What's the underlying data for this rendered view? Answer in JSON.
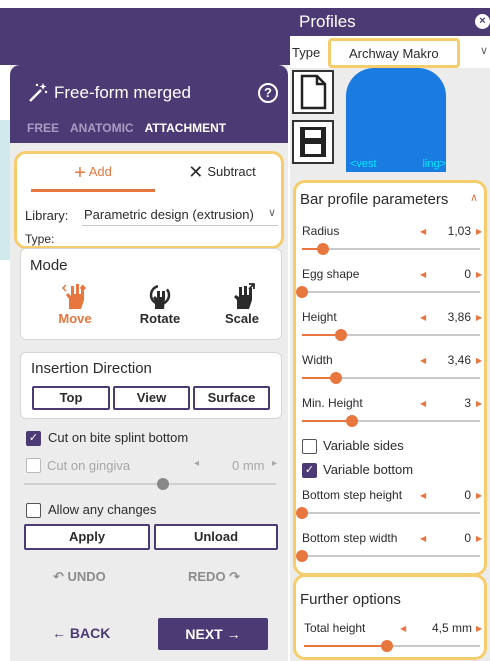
{
  "left_panel": {
    "title": "Free-form merged",
    "help_symbol": "?",
    "mode_tabs": [
      "FREE",
      "ANATOMIC",
      "ATTACHMENT"
    ],
    "active_mode_tab": "ATTACHMENT",
    "add_tab": "Add",
    "subtract_tab": "Subtract",
    "library_label": "Library:",
    "library_value": "Parametric design (extrusion)",
    "type_label": "Type:",
    "mode": {
      "label": "Mode",
      "buttons": [
        "Move",
        "Rotate",
        "Scale"
      ],
      "selected": "Move"
    },
    "insertion": {
      "label": "Insertion Direction",
      "buttons": [
        "Top",
        "View",
        "Surface"
      ]
    },
    "cut_bite_label": "Cut on bite splint bottom",
    "cut_bite_checked": true,
    "cut_gingiva_label": "Cut on gingiva",
    "cut_gingiva_value": "0 mm",
    "cut_gingiva_level": 0.55,
    "allow_changes_label": "Allow any changes",
    "apply_label": "Apply",
    "unload_label": "Unload",
    "undo_label": "UNDO",
    "redo_label": "REDO",
    "back_label": "BACK",
    "next_label": "NEXT"
  },
  "right_panel": {
    "title": "Profiles",
    "close_symbol": "×",
    "type_label": "Type",
    "type_value": "Archway Makro",
    "preview_left_label": "<vest",
    "preview_right_label": "ling>",
    "parameters_title": "Bar profile parameters",
    "parameters": [
      {
        "label": "Radius",
        "value": "1,03",
        "level": 0.12
      },
      {
        "label": "Egg shape",
        "value": "0",
        "level": 0.0
      },
      {
        "label": "Height",
        "value": "3,86",
        "level": 0.22
      },
      {
        "label": "Width",
        "value": "3,46",
        "level": 0.19
      },
      {
        "label": "Min. Height",
        "value": "3",
        "level": 0.28
      }
    ],
    "variable_sides_label": "Variable sides",
    "variable_sides_checked": false,
    "variable_bottom_label": "Variable bottom",
    "variable_bottom_checked": true,
    "step_parameters": [
      {
        "label": "Bottom step height",
        "value": "0",
        "level": 0.0
      },
      {
        "label": "Bottom step width",
        "value": "0",
        "level": 0.0
      }
    ],
    "further_title": "Further options",
    "total_height_label": "Total height",
    "total_height_value": "4,5 mm",
    "total_height_level": 0.47
  },
  "colors": {
    "primary": "#4c3a74",
    "accent": "#e8763f",
    "highlight": "#f6cd6c",
    "preview_blue": "#1a7be0"
  }
}
